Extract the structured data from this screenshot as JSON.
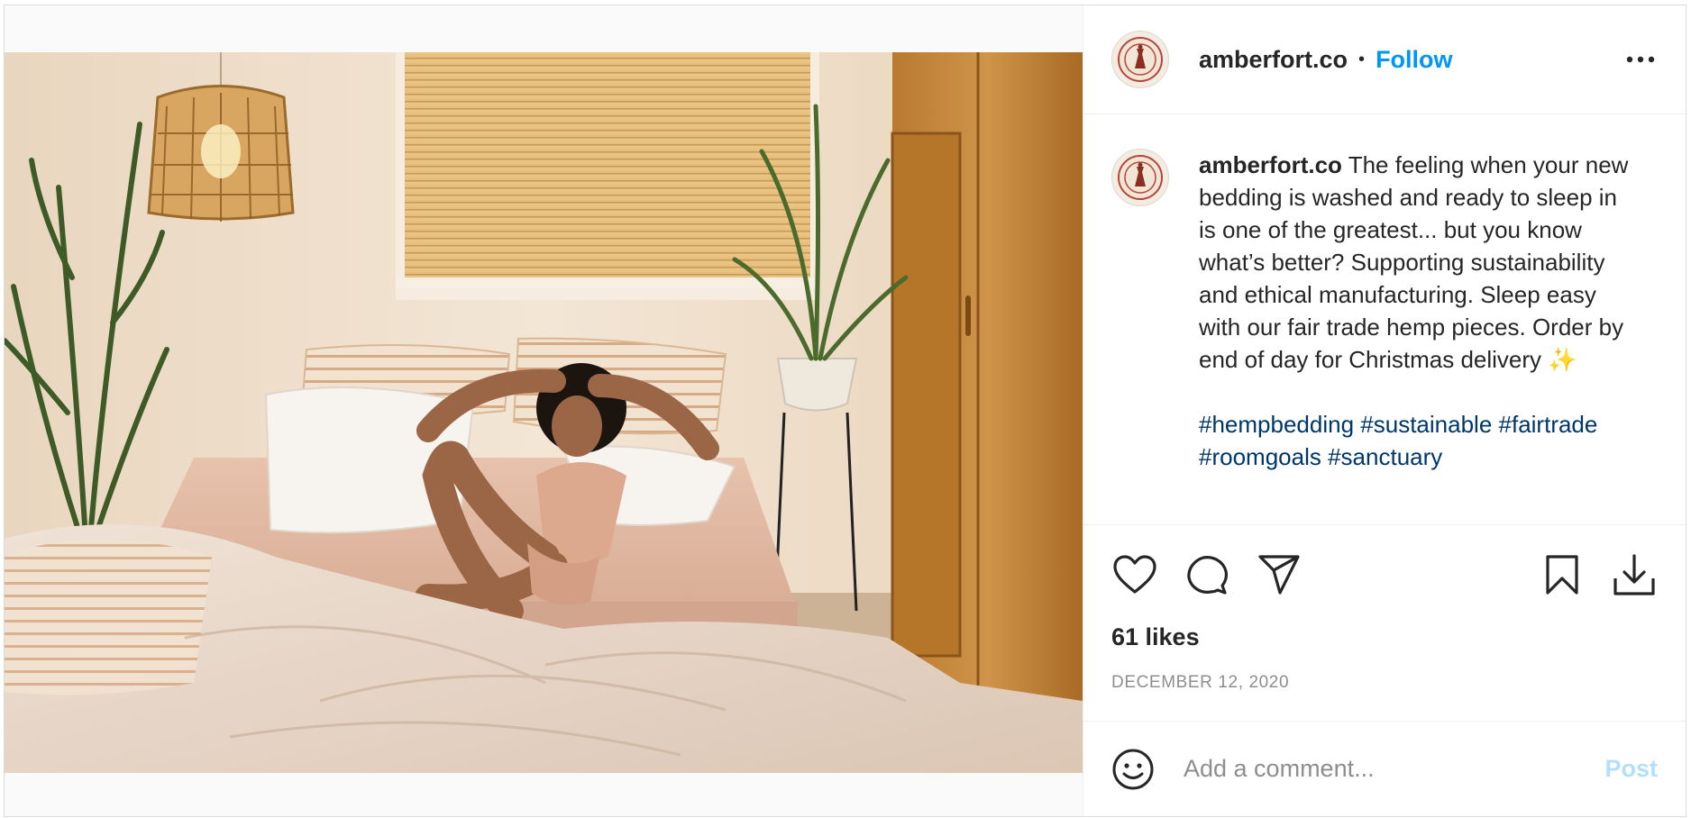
{
  "post": {
    "username": "amberfort.co",
    "follow_label": "Follow",
    "separator": "•",
    "avatar_icon": "amberfort-logo-icon",
    "more_icon": "more-options-icon",
    "caption_text": "The feeling when your new bedding is washed and ready to sleep in is one of the greatest... but you know what’s better? Supporting sustainability and ethical manufacturing. Sleep easy with our fair trade hemp pieces. Order by end of day for Christmas delivery ✨",
    "hashtags": [
      "#hempbedding",
      "#sustainable",
      "#fairtrade",
      "#roomgoals",
      "#sanctuary"
    ],
    "likes_label": "61 likes",
    "date_label": "DECEMBER 12, 2020"
  },
  "actions": {
    "like_icon": "heart-icon",
    "comment_icon": "comment-icon",
    "share_icon": "share-icon",
    "save_icon": "bookmark-icon",
    "download_icon": "download-icon"
  },
  "comment": {
    "placeholder": "Add a comment...",
    "post_label": "Post",
    "emoji_icon": "emoji-icon"
  },
  "colors": {
    "follow": "#0095f6",
    "hashtag": "#00376b",
    "post_disabled": "#b2dffc",
    "secondary_text": "#8e8e8e",
    "border": "#dbdbdb"
  }
}
